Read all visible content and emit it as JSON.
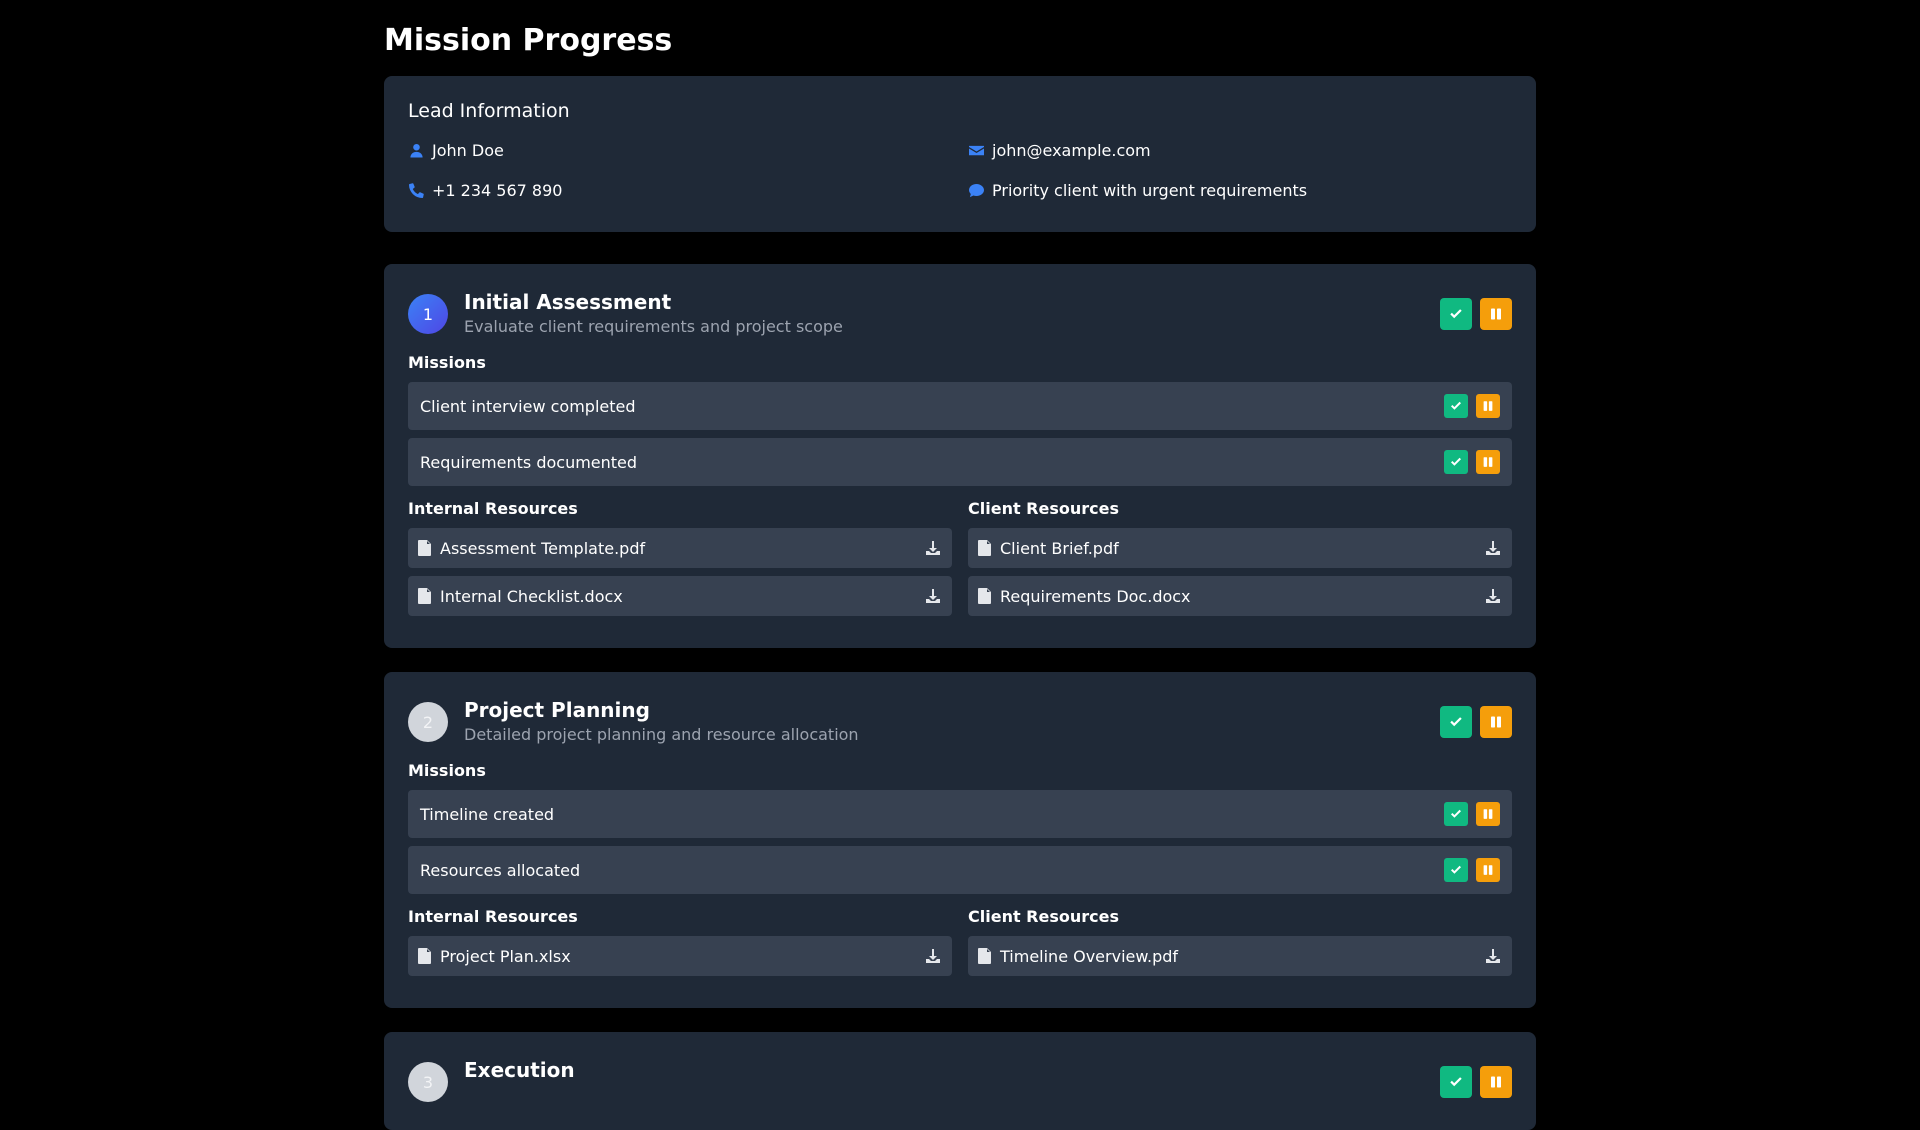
{
  "page": {
    "title": "Mission Progress"
  },
  "lead": {
    "title": "Lead Information",
    "name": "John Doe",
    "email": "john@example.com",
    "phone": "+1 234 567 890",
    "note": "Priority client with urgent requirements"
  },
  "labels": {
    "missions": "Missions",
    "internal_resources": "Internal Resources",
    "client_resources": "Client Resources"
  },
  "stages": [
    {
      "number": "1",
      "title": "Initial Assessment",
      "subtitle": "Evaluate client requirements and project scope",
      "missions": [
        "Client interview completed",
        "Requirements documented"
      ],
      "internal_resources": [
        "Assessment Template.pdf",
        "Internal Checklist.docx"
      ],
      "client_resources": [
        "Client Brief.pdf",
        "Requirements Doc.docx"
      ]
    },
    {
      "number": "2",
      "title": "Project Planning",
      "subtitle": "Detailed project planning and resource allocation",
      "missions": [
        "Timeline created",
        "Resources allocated"
      ],
      "internal_resources": [
        "Project Plan.xlsx"
      ],
      "client_resources": [
        "Timeline Overview.pdf"
      ]
    },
    {
      "number": "3",
      "title": "Execution"
    }
  ],
  "colors": {
    "background": "#000000",
    "card": "#1f2937",
    "row": "#374151",
    "accent_blue": "#3b82f6",
    "complete_green": "#10b981",
    "pause_amber": "#f59e0b",
    "muted_text": "#9ca3af"
  },
  "icons": {
    "lead_name": "user-icon",
    "lead_email": "envelope-icon",
    "lead_phone": "phone-icon",
    "lead_note": "comment-icon",
    "complete": "check-icon",
    "pause": "pause-icon",
    "file": "file-icon",
    "download": "download-icon"
  }
}
